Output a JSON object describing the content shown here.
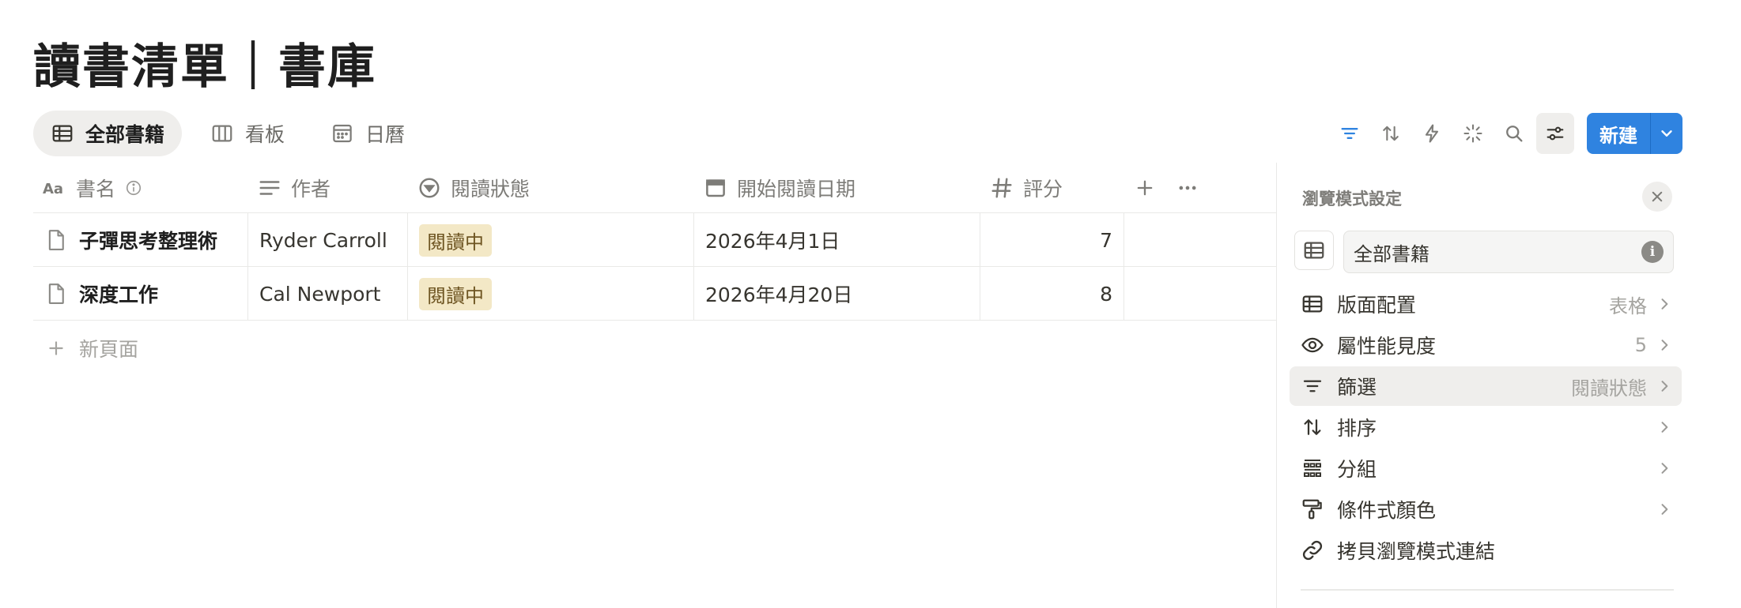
{
  "page": {
    "title": "讀書清單｜書庫"
  },
  "tabs": [
    {
      "label": "全部書籍",
      "icon": "table-icon",
      "active": true
    },
    {
      "label": "看板",
      "icon": "board-icon",
      "active": false
    },
    {
      "label": "日曆",
      "icon": "calendar-icon",
      "active": false
    }
  ],
  "toolbar": {
    "icons": [
      "filter-icon",
      "sort-icon",
      "automation-icon",
      "ai-sparkle-icon",
      "search-icon",
      "settings-sliders-icon"
    ],
    "new_label": "新建",
    "accent": "#2f83e0"
  },
  "table": {
    "columns": [
      {
        "label": "書名",
        "icon": "title-aa-icon"
      },
      {
        "label": "作者",
        "icon": "text-lines-icon"
      },
      {
        "label": "閱讀狀態",
        "icon": "status-icon"
      },
      {
        "label": "開始閱讀日期",
        "icon": "calendar-icon"
      },
      {
        "label": "評分",
        "icon": "hash-icon"
      }
    ],
    "rows": [
      {
        "title": "子彈思考整理術",
        "author": "Ryder Carroll",
        "status": "閱讀中",
        "start": "2026年4月1日",
        "rating": "7"
      },
      {
        "title": "深度工作",
        "author": "Cal Newport",
        "status": "閱讀中",
        "start": "2026年4月20日",
        "rating": "8"
      }
    ],
    "add_row_label": "新頁面",
    "status_color": "#f3e8c6"
  },
  "panel": {
    "heading": "瀏覽模式設定",
    "view_name": "全部書籍",
    "items": [
      {
        "label": "版面配置",
        "value": "表格",
        "icon": "layout-table-icon"
      },
      {
        "label": "屬性能見度",
        "value": "5",
        "icon": "eye-icon"
      },
      {
        "label": "篩選",
        "value": "閱讀狀態",
        "icon": "filter-icon"
      },
      {
        "label": "排序",
        "value": "",
        "icon": "sort-icon"
      },
      {
        "label": "分組",
        "value": "",
        "icon": "group-icon"
      },
      {
        "label": "條件式顏色",
        "value": "",
        "icon": "paint-roller-icon"
      },
      {
        "label": "拷貝瀏覽模式連結",
        "value": "",
        "icon": "link-icon"
      }
    ]
  }
}
